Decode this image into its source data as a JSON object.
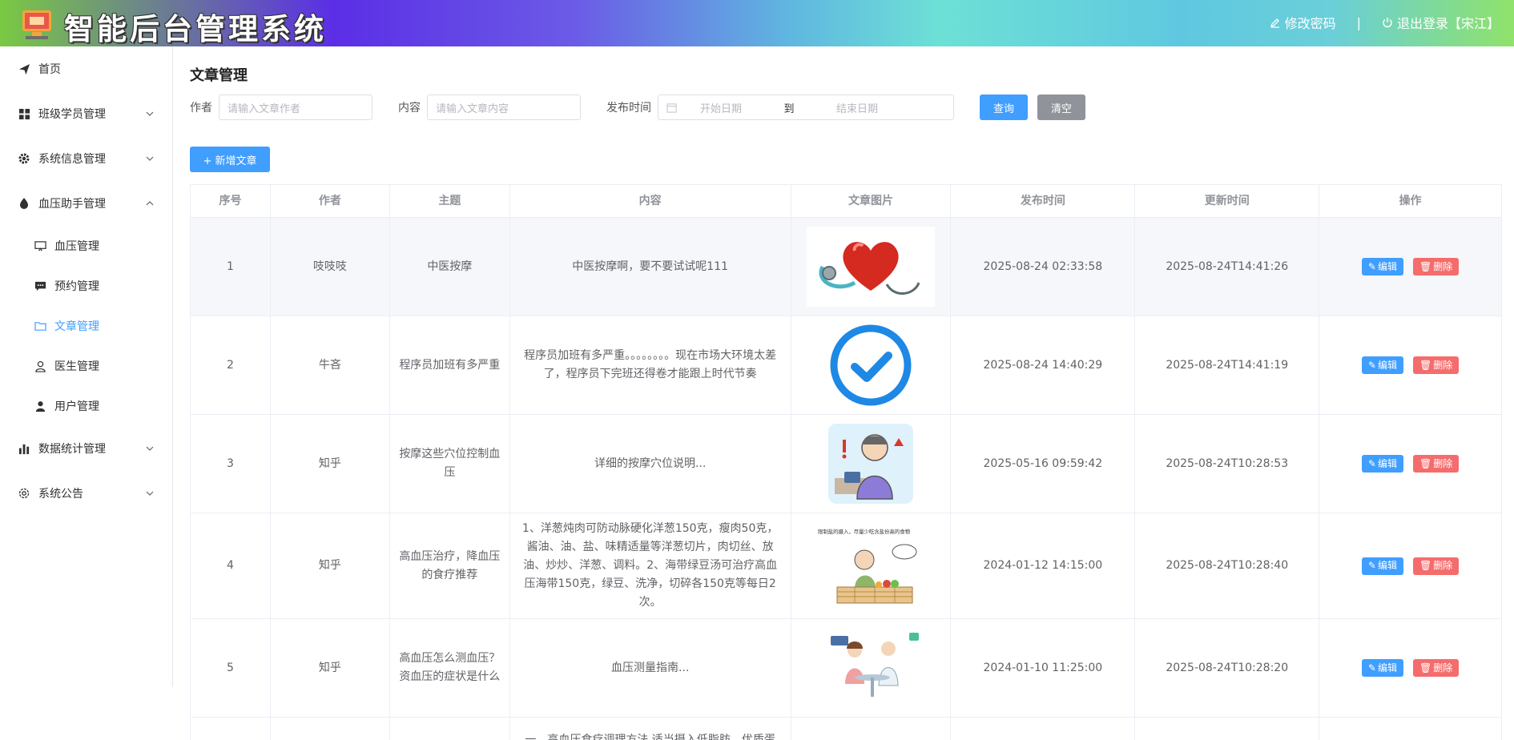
{
  "header": {
    "title": "智能后台管理系统",
    "change_password": "修改密码",
    "separator": "|",
    "logout": "退出登录【宋江】"
  },
  "sidebar": {
    "items": [
      {
        "label": "首页",
        "icon": "send-icon"
      },
      {
        "label": "班级学员管理",
        "icon": "grid-icon"
      },
      {
        "label": "系统信息管理",
        "icon": "gear-icon"
      },
      {
        "label": "血压助手管理",
        "icon": "drop-icon"
      },
      {
        "label": "血压管理",
        "icon": "monitor-icon"
      },
      {
        "label": "预约管理",
        "icon": "chat-icon"
      },
      {
        "label": "文章管理",
        "icon": "folder-icon"
      },
      {
        "label": "医生管理",
        "icon": "user-outline-icon"
      },
      {
        "label": "用户管理",
        "icon": "user-icon"
      },
      {
        "label": "数据统计管理",
        "icon": "bar-chart-icon"
      },
      {
        "label": "系统公告",
        "icon": "settings-icon"
      }
    ]
  },
  "main": {
    "title": "文章管理",
    "filters": {
      "author_label": "作者",
      "author_placeholder": "请输入文章作者",
      "content_label": "内容",
      "content_placeholder": "请输入文章内容",
      "date_label": "发布时间",
      "start_placeholder": "开始日期",
      "to": "到",
      "end_placeholder": "结束日期",
      "query": "查询",
      "clear": "清空"
    },
    "add_button": "+ 新增文章",
    "columns": [
      "序号",
      "作者",
      "主题",
      "内容",
      "文章图片",
      "发布时间",
      "更新时间",
      "操作"
    ],
    "edit_label": "编辑",
    "delete_label": "删除",
    "rows": [
      {
        "no": "1",
        "author": "吱吱吱",
        "topic": "中医按摩",
        "content": "中医按摩啊，要不要试试呢111",
        "image": "heart-stethoscope",
        "published": "2025-08-24 02:33:58",
        "updated": "2025-08-24T14:41:26"
      },
      {
        "no": "2",
        "author": "牛吝",
        "topic": "程序员加班有多严重",
        "content": "程序员加班有多严重。。。。。。。。现在市场大环境太差了，程序员下完班还得卷才能跟上时代节奏",
        "image": "check-circle",
        "published": "2025-08-24 14:40:29",
        "updated": "2025-08-24T14:41:19"
      },
      {
        "no": "3",
        "author": "知乎",
        "topic": "按摩这些穴位控制血压",
        "content": "详细的按摩穴位说明...",
        "image": "cartoon-patient",
        "published": "2025-05-16 09:59:42",
        "updated": "2025-08-24T10:28:53"
      },
      {
        "no": "4",
        "author": "知乎",
        "topic": "高血压治疗，降血压的食疗推荐",
        "content": "1、洋葱炖肉可防动脉硬化洋葱150克，瘦肉50克，酱油、油、盐、味精适量等洋葱切片，肉切丝、放油、炒炒、洋葱、调料。2、海带绿豆汤可治疗高血压海带150克，绿豆、洗净，切碎各150克等每日2次。",
        "image": "food-table",
        "image_caption": "限制盐的摄入，尽量少吃含盐份高的食物",
        "published": "2024-01-12 14:15:00",
        "updated": "2025-08-24T10:28:40"
      },
      {
        "no": "5",
        "author": "知乎",
        "topic": "高血压怎么测血压？资血压的症状是什么",
        "content": "血压测量指南...",
        "image": "doctor-patient",
        "published": "2024-01-10 11:25:00",
        "updated": "2025-08-24T10:28:20"
      },
      {
        "no": "",
        "author": "",
        "topic": "",
        "content": "一、高血压食疗调理方法 适当摄入低脂肪、优质蛋",
        "image": "",
        "published": "",
        "updated": ""
      }
    ]
  }
}
